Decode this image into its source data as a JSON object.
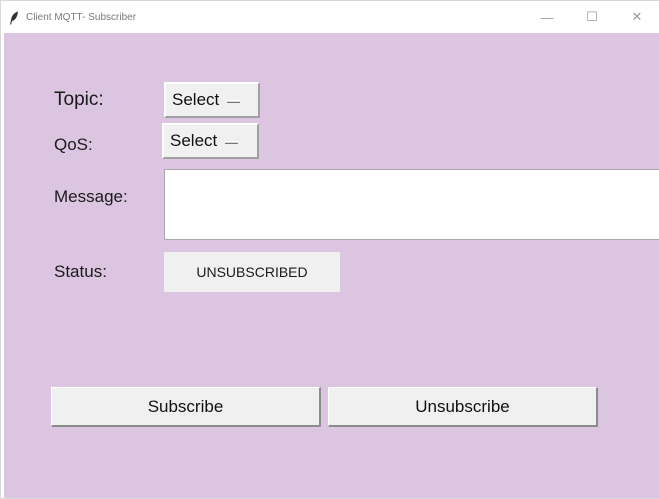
{
  "window": {
    "title": "Client MQTT- Subscriber",
    "controls": {
      "minimize": "—",
      "maximize": "☐",
      "close": "✕"
    },
    "icon": "feather-icon"
  },
  "colors": {
    "background": "#dcc5e1",
    "button_face": "#f0f0f0",
    "text": "#1a1a1a"
  },
  "form": {
    "topic_label": "Topic:",
    "topic_value": "Select",
    "qos_label": "QoS:",
    "qos_value": "Select",
    "message_label": "Message:",
    "message_value": "",
    "status_label": "Status:",
    "status_value": "UNSUBSCRIBED"
  },
  "actions": {
    "subscribe": "Subscribe",
    "unsubscribe": "Unsubscribe"
  }
}
